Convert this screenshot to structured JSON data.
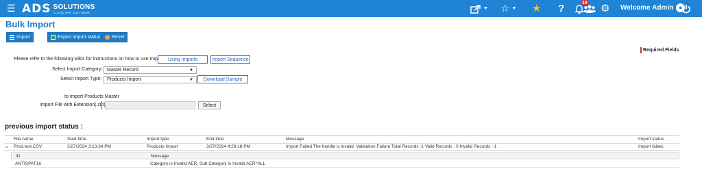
{
  "header": {
    "brand_main": "ADS",
    "brand_name": "SOLUTIONS",
    "brand_tag": "CLOUD ERP SOFTWARE",
    "notification_count": "19",
    "welcome": "Welcome Admin"
  },
  "page": {
    "title": "Bulk Import"
  },
  "toolbar": {
    "import_label": "Import",
    "export_label": "Export import status",
    "reset_label": "Reset"
  },
  "form": {
    "required_fields": "Required Fields",
    "wiki_text": "Please refer to the following wikis for instructions on how to use Imports:",
    "using_imports": "Using Imports",
    "import_sequence": "Import Sequence",
    "category_label": "Select Import Category:",
    "category_value": "Master Record",
    "type_label": "Select Import Type:",
    "type_value": "Products Import",
    "download_sample": "Download Sample",
    "import_hint": "to import Products Master",
    "file_label": "Import File with Extension(.zip)",
    "select_btn": "Select"
  },
  "history": {
    "title": "previous import status :",
    "columns": {
      "file_name": "File name",
      "start_time": "Start time",
      "import_type": "Import type",
      "end_time": "End time",
      "message": "Message",
      "import_status": "Import status"
    },
    "rows": [
      {
        "file_name": "Prod.test.CSV",
        "start_time": "3/27/2024 3:13:34 PM",
        "import_type": "Products Import",
        "end_time": "3/27/2024 4:29:18 PM",
        "message": "Import Failed The handle is invalid. Validation Failure Total Records :1 Valid Records : 0 Invalid Records : 1",
        "import_status": "Import failed."
      }
    ],
    "detail": {
      "columns": {
        "id": "ID",
        "message": "Message"
      },
      "rows": [
        {
          "id": "ANTISPAT16",
          "message": "Category is Invalid AER, Sub Category is Invalid AER^ALL"
        }
      ]
    }
  },
  "icons": {
    "menu": "hamburger-icon",
    "share": "share-icon",
    "favorites": "star-outline-icon",
    "featured": "star-filled-icon",
    "help": "question-icon",
    "notifications": "bell-icon",
    "users": "users-icon",
    "settings": "gear-icon",
    "account": "user-circle-icon",
    "power": "power-icon"
  },
  "colors": {
    "topbar": "#1f84d6",
    "accent": "#1f7bc6",
    "star": "#f5c518",
    "badge": "#e4292e",
    "required": "#c0392b"
  }
}
